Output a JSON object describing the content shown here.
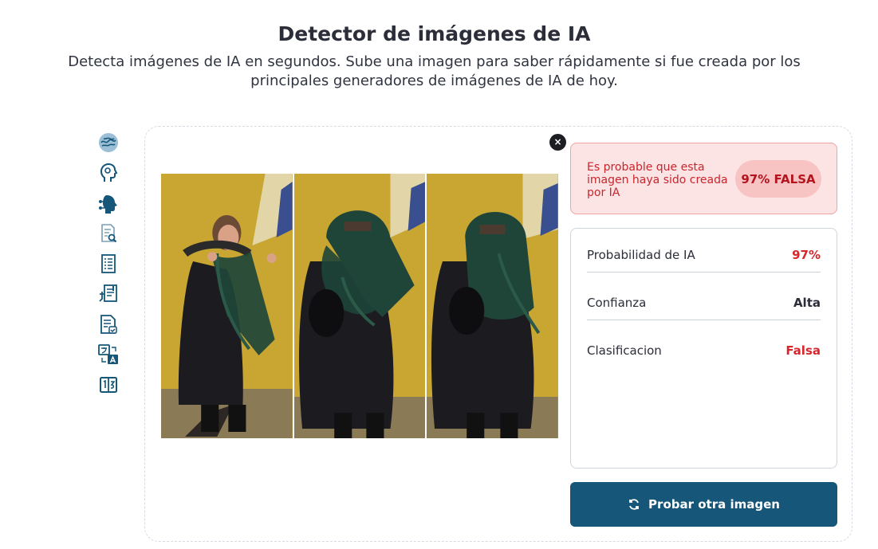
{
  "header": {
    "title": "Detector de imágenes de IA",
    "subtitle": "Detecta imágenes de IA en segundos. Sube una imagen para saber rápidamente si fue creada por los principales generadores de imágenes de IA de hoy."
  },
  "tools": [
    {
      "icon": "brain-icon"
    },
    {
      "icon": "ai-head-icon"
    },
    {
      "icon": "ai-circuit-head-icon"
    },
    {
      "icon": "document-search-icon"
    },
    {
      "icon": "checklist-icon"
    },
    {
      "icon": "plagiarism-check-icon"
    },
    {
      "icon": "document-check-icon"
    },
    {
      "icon": "translate-icon"
    },
    {
      "icon": "word-counter-icon"
    }
  ],
  "result": {
    "verdict_text": "Es probable que esta imagen haya sido creada por IA",
    "verdict_badge": "97% FALSA",
    "stats": [
      {
        "label": "Probabilidad de IA",
        "value": "97%",
        "color": "#d8262d"
      },
      {
        "label": "Confianza",
        "value": "Alta",
        "color": "#2b2d38"
      },
      {
        "label": "Clasificacion",
        "value": "Falsa",
        "color": "#d8262d"
      }
    ],
    "retry_label": "Probar otra imagen"
  },
  "close_symbol": "×",
  "colors": {
    "primary": "#155679",
    "danger": "#d8262d",
    "danger_bg": "#fde4e4"
  }
}
